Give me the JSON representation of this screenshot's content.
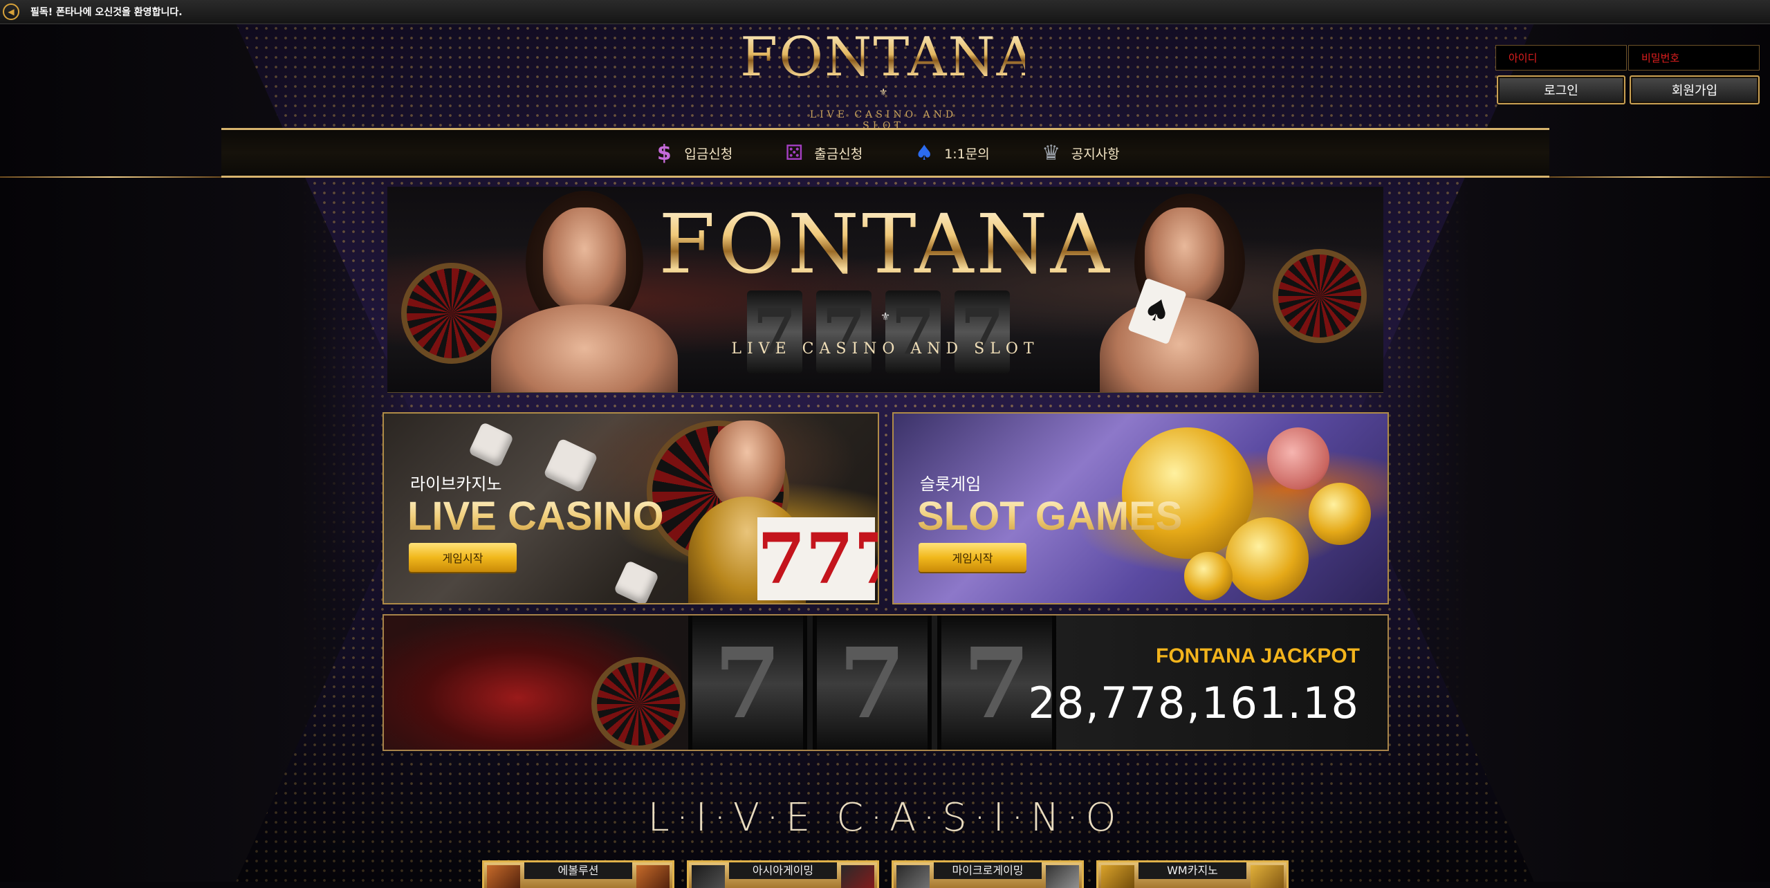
{
  "notice": {
    "text": "필독! 폰타나에 오신것을 환영합니다."
  },
  "header": {
    "logo": "FONTANA",
    "logo_ornament": "⚜",
    "logo_subtitle": "LIVE CASINO AND SLOT",
    "login": {
      "id_placeholder": "아이디",
      "password_placeholder": "비밀번호",
      "login_label": "로그인",
      "signup_label": "회원가입"
    }
  },
  "nav": {
    "items": [
      {
        "label": "입금신청",
        "icon": "dollar-icon",
        "glyph": "$",
        "color": "#c56ad9"
      },
      {
        "label": "출금신청",
        "icon": "dice-icon",
        "glyph": "⚄",
        "color": "#a43fc2"
      },
      {
        "label": "1:1문의",
        "icon": "top-hat-icon",
        "glyph": "♠",
        "color": "#2c6cf0"
      },
      {
        "label": "공지사항",
        "icon": "trophy-icon",
        "glyph": "♛",
        "color": "#9aa0a8"
      }
    ]
  },
  "banner": {
    "logo": "FONTANA",
    "ornament": "⚜",
    "subtitle": "LIVE CASINO AND SLOT"
  },
  "games": {
    "live": {
      "title_kr": "라이브카지노",
      "title_en": "LIVE CASINO",
      "button": "게임시작"
    },
    "slot": {
      "title_kr": "슬롯게임",
      "title_en": "SLOT GAMES",
      "button": "게임시작"
    }
  },
  "jackpot": {
    "title": "FONTANA JACKPOT",
    "value": "28,778,161.18"
  },
  "section": {
    "title": "L·I·V·E  C·A·S·I·N·O"
  },
  "providers": [
    {
      "label": "에볼루션"
    },
    {
      "label": "아시아게이밍"
    },
    {
      "label": "마이크로게이밍"
    },
    {
      "label": "WM카지노"
    }
  ],
  "colors": {
    "gold": "#d7b46e",
    "jackpot_title": "#f3b41c",
    "login_placeholder": "#e01e1e",
    "button_yellow": "#f1b81c"
  }
}
